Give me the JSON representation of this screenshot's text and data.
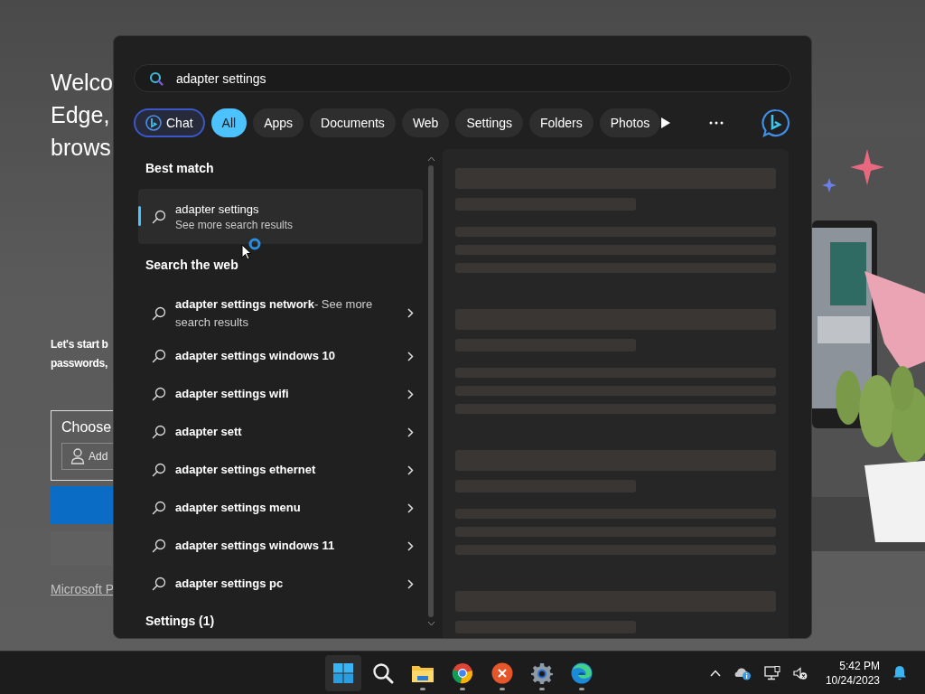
{
  "background_page": {
    "heading_lines": [
      "Welco",
      "Edge,",
      "brows"
    ],
    "intro_lines": [
      "Let's start b",
      "passwords,"
    ],
    "choose_label": "Choose",
    "account_field": "Add",
    "link": "Microsoft P"
  },
  "search": {
    "value": "adapter settings"
  },
  "filters": [
    {
      "label": "Chat",
      "kind": "chat",
      "selected": false
    },
    {
      "label": "All",
      "kind": "text",
      "selected": true
    },
    {
      "label": "Apps",
      "kind": "text",
      "selected": false
    },
    {
      "label": "Documents",
      "kind": "text",
      "selected": false
    },
    {
      "label": "Web",
      "kind": "text",
      "selected": false
    },
    {
      "label": "Settings",
      "kind": "text",
      "selected": false
    },
    {
      "label": "Folders",
      "kind": "text",
      "selected": false
    },
    {
      "label": "Photos",
      "kind": "text",
      "selected": false
    }
  ],
  "results": {
    "best_match": {
      "heading": "Best match",
      "title": "adapter settings",
      "subtitle": "See more search results",
      "selected": true
    },
    "web": {
      "heading": "Search the web",
      "items": [
        {
          "text": "adapter settings network",
          "suffix": "- See more search results"
        },
        {
          "text": "adapter settings windows 10"
        },
        {
          "text": "adapter settings wifi"
        },
        {
          "text": "adapter sett"
        },
        {
          "text": "adapter settings ethernet"
        },
        {
          "text": "adapter settings menu"
        },
        {
          "text": "adapter settings windows 11"
        },
        {
          "text": "adapter settings pc"
        }
      ]
    },
    "settings_heading": "Settings (1)"
  },
  "preview": {
    "loading": true
  },
  "cursor": {
    "busy": true
  },
  "taskbar": {
    "apps": [
      {
        "kind": "start",
        "selected": true,
        "running": false
      },
      {
        "kind": "search",
        "selected": false,
        "running": false
      },
      {
        "kind": "folder",
        "selected": false,
        "running": true
      },
      {
        "kind": "browser",
        "selected": false,
        "running": true
      },
      {
        "kind": "close-app",
        "selected": false,
        "running": true
      },
      {
        "kind": "gear",
        "selected": false,
        "running": true
      },
      {
        "kind": "edge",
        "selected": false,
        "running": true
      }
    ],
    "tray": {
      "time": "5:42 PM",
      "date": "10/24/2023"
    }
  }
}
